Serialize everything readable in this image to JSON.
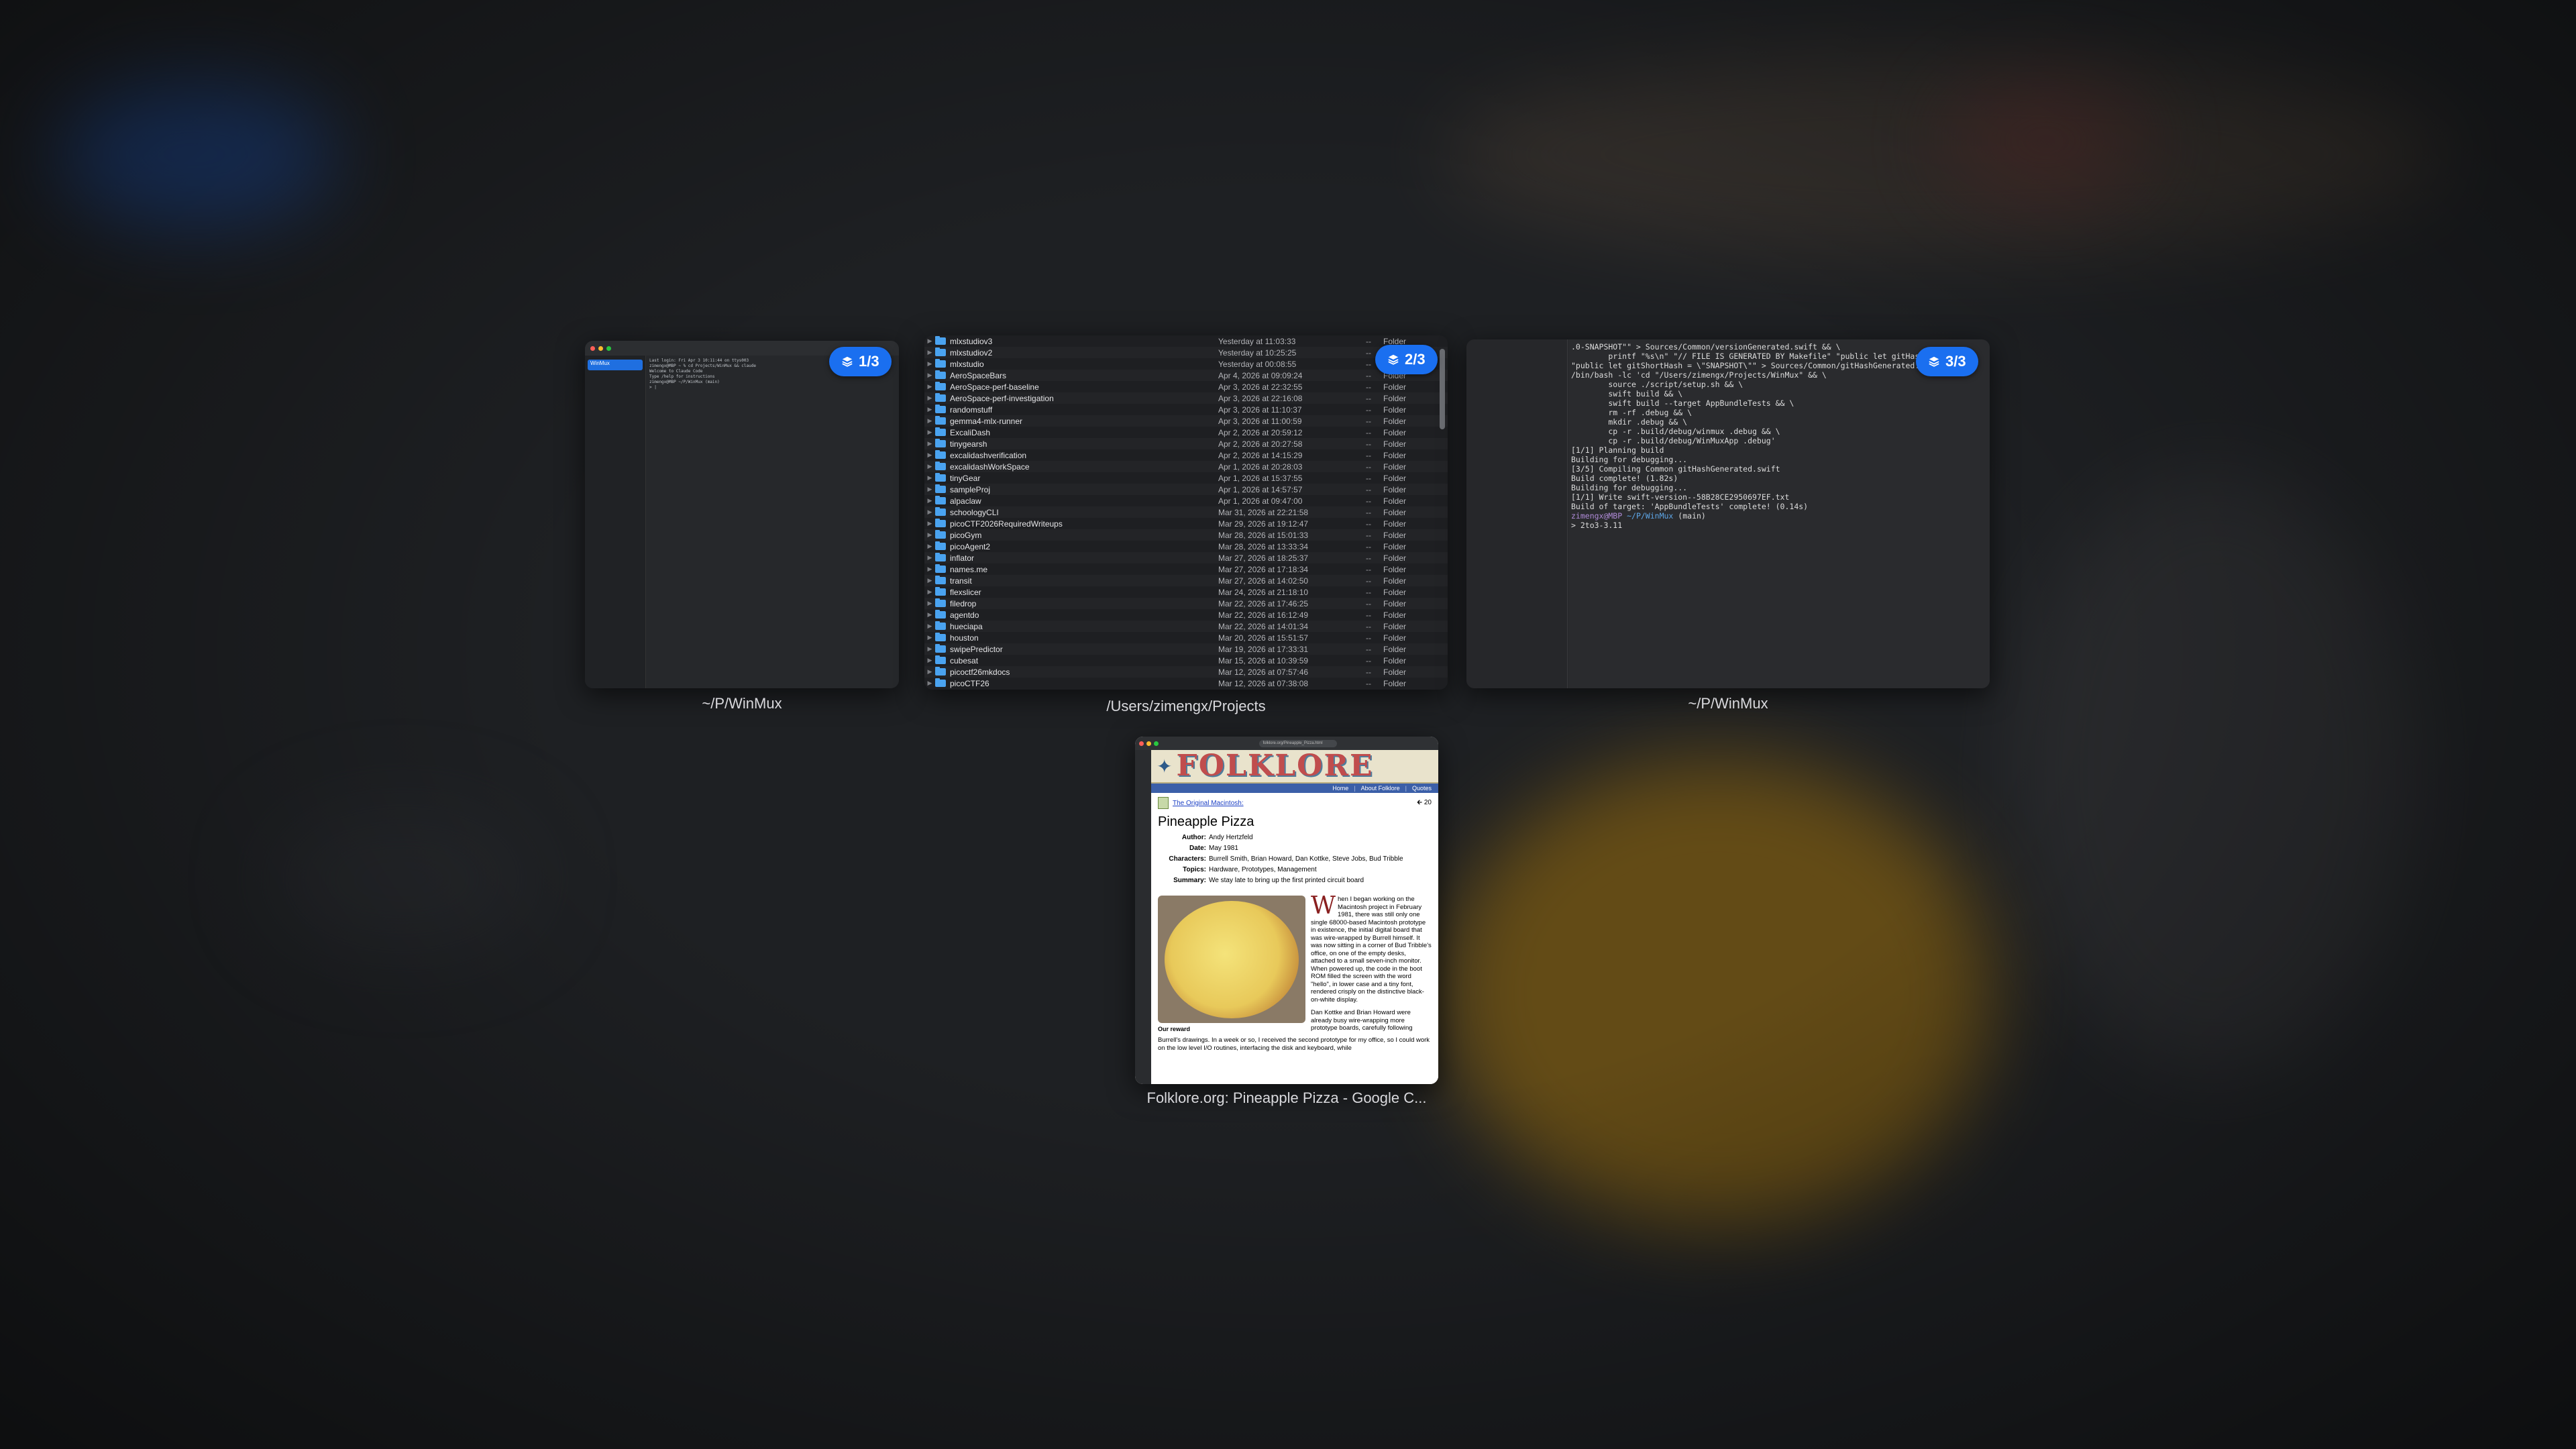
{
  "badge_windows": {
    "w1": "1/3",
    "w2": "2/3",
    "w3": "3/3"
  },
  "windows": [
    {
      "caption": "~/P/WinMux"
    },
    {
      "caption": "/Users/zimengx/Projects"
    },
    {
      "caption": "~/P/WinMux"
    },
    {
      "caption": "Folklore.org: Pineapple Pizza - Google C..."
    }
  ],
  "w1": {
    "sidebar_item": "WinMux",
    "lines": [
      "Last login: Fri Apr 3 10:11:44 on ttys003",
      "zimengx@MBP ~ % cd Projects/WinMux && claude",
      "Welcome to Claude Code",
      "Type /help for instructions",
      "zimengx@MBP ~/P/WinMux (main)",
      "> |"
    ]
  },
  "finder": {
    "rows": [
      {
        "name": "mlxstudiov3",
        "date": "Yesterday at 11:03:33",
        "size": "--",
        "kind": "Folder"
      },
      {
        "name": "mlxstudiov2",
        "date": "Yesterday at 10:25:25",
        "size": "--",
        "kind": "Folder"
      },
      {
        "name": "mlxstudio",
        "date": "Yesterday at 00:08:55",
        "size": "--",
        "kind": "Folder"
      },
      {
        "name": "AeroSpaceBars",
        "date": "Apr 4, 2026 at 09:09:24",
        "size": "--",
        "kind": "Folder"
      },
      {
        "name": "AeroSpace-perf-baseline",
        "date": "Apr 3, 2026 at 22:32:55",
        "size": "--",
        "kind": "Folder"
      },
      {
        "name": "AeroSpace-perf-investigation",
        "date": "Apr 3, 2026 at 22:16:08",
        "size": "--",
        "kind": "Folder"
      },
      {
        "name": "randomstuff",
        "date": "Apr 3, 2026 at 11:10:37",
        "size": "--",
        "kind": "Folder"
      },
      {
        "name": "gemma4-mlx-runner",
        "date": "Apr 3, 2026 at 11:00:59",
        "size": "--",
        "kind": "Folder"
      },
      {
        "name": "ExcaliDash",
        "date": "Apr 2, 2026 at 20:59:12",
        "size": "--",
        "kind": "Folder"
      },
      {
        "name": "tinygearsh",
        "date": "Apr 2, 2026 at 20:27:58",
        "size": "--",
        "kind": "Folder"
      },
      {
        "name": "excalidashverification",
        "date": "Apr 2, 2026 at 14:15:29",
        "size": "--",
        "kind": "Folder"
      },
      {
        "name": "excalidashWorkSpace",
        "date": "Apr 1, 2026 at 20:28:03",
        "size": "--",
        "kind": "Folder"
      },
      {
        "name": "tinyGear",
        "date": "Apr 1, 2026 at 15:37:55",
        "size": "--",
        "kind": "Folder"
      },
      {
        "name": "sampleProj",
        "date": "Apr 1, 2026 at 14:57:57",
        "size": "--",
        "kind": "Folder"
      },
      {
        "name": "alpaclaw",
        "date": "Apr 1, 2026 at 09:47:00",
        "size": "--",
        "kind": "Folder"
      },
      {
        "name": "schoologyCLI",
        "date": "Mar 31, 2026 at 22:21:58",
        "size": "--",
        "kind": "Folder"
      },
      {
        "name": "picoCTF2026RequiredWriteups",
        "date": "Mar 29, 2026 at 19:12:47",
        "size": "--",
        "kind": "Folder"
      },
      {
        "name": "picoGym",
        "date": "Mar 28, 2026 at 15:01:33",
        "size": "--",
        "kind": "Folder"
      },
      {
        "name": "picoAgent2",
        "date": "Mar 28, 2026 at 13:33:34",
        "size": "--",
        "kind": "Folder"
      },
      {
        "name": "inflator",
        "date": "Mar 27, 2026 at 18:25:37",
        "size": "--",
        "kind": "Folder"
      },
      {
        "name": "names.me",
        "date": "Mar 27, 2026 at 17:18:34",
        "size": "--",
        "kind": "Folder"
      },
      {
        "name": "transit",
        "date": "Mar 27, 2026 at 14:02:50",
        "size": "--",
        "kind": "Folder"
      },
      {
        "name": "flexslicer",
        "date": "Mar 24, 2026 at 21:18:10",
        "size": "--",
        "kind": "Folder"
      },
      {
        "name": "filedrop",
        "date": "Mar 22, 2026 at 17:46:25",
        "size": "--",
        "kind": "Folder"
      },
      {
        "name": "agentdo",
        "date": "Mar 22, 2026 at 16:12:49",
        "size": "--",
        "kind": "Folder"
      },
      {
        "name": "hueciapa",
        "date": "Mar 22, 2026 at 14:01:34",
        "size": "--",
        "kind": "Folder"
      },
      {
        "name": "houston",
        "date": "Mar 20, 2026 at 15:51:57",
        "size": "--",
        "kind": "Folder"
      },
      {
        "name": "swipePredictor",
        "date": "Mar 19, 2026 at 17:33:31",
        "size": "--",
        "kind": "Folder"
      },
      {
        "name": "cubesat",
        "date": "Mar 15, 2026 at 10:39:59",
        "size": "--",
        "kind": "Folder"
      },
      {
        "name": "picoctf26mkdocs",
        "date": "Mar 12, 2026 at 07:57:46",
        "size": "--",
        "kind": "Folder"
      },
      {
        "name": "picoCTF26",
        "date": "Mar 12, 2026 at 07:38:08",
        "size": "--",
        "kind": "Folder"
      }
    ]
  },
  "terminal": {
    "lines": [
      ".0-SNAPSHOT\"\" > Sources/Common/versionGenerated.swift && \\",
      "        printf \"%s\\n\" \"// FILE IS GENERATED BY Makefile\" \"public let gitHash",
      "\"public let gitShortHash = \\\"SNAPSHOT\\\"\" > Sources/Common/gitHashGenerated.sw",
      "/bin/bash -lc 'cd \"/Users/zimengx/Projects/WinMux\" && \\",
      "        source ./script/setup.sh && \\",
      "        swift build && \\",
      "        swift build --target AppBundleTests && \\",
      "        rm -rf .debug && \\",
      "        mkdir .debug && \\",
      "        cp -r .build/debug/winmux .debug && \\",
      "        cp -r .build/debug/WinMuxApp .debug'",
      "[1/1] Planning build",
      "Building for debugging...",
      "[3/5] Compiling Common gitHashGenerated.swift",
      "Build complete! (1.82s)",
      "Building for debugging...",
      "[1/1] Write swift-version--58B28CE2950697EF.txt",
      "Build of target: 'AppBundleTests' complete! (0.14s)"
    ],
    "prompt_user": "zimengx@MBP",
    "prompt_path": "~/P/WinMux",
    "prompt_branch": "(main)",
    "last_line": "> 2to3-3.11"
  },
  "browser": {
    "url": "folklore.org/Pineapple_Pizza.html",
    "logo": "FOLKLORE",
    "nav": [
      "Home",
      "About Folklore",
      "Quotes"
    ],
    "book_link": "The Original Macintosh:",
    "page_num": "20",
    "title": "Pineapple Pizza",
    "meta": [
      {
        "k": "Author:",
        "v": "Andy Hertzfeld"
      },
      {
        "k": "Date:",
        "v": "May 1981"
      },
      {
        "k": "Characters:",
        "v": "Burrell Smith, Brian Howard, Dan Kottke, Steve Jobs, Bud Tribble"
      },
      {
        "k": "Topics:",
        "v": "Hardware, Prototypes, Management"
      },
      {
        "k": "Summary:",
        "v": "We stay late to bring up the first printed circuit board"
      }
    ],
    "photo_caption": "Our reward",
    "dropcap": "W",
    "para1": "hen I began working on the Macintosh project in February 1981, there was still only one single 68000-based Macintosh prototype in existence, the initial digital board that was wire-wrapped by Burrell himself. It was now sitting in a corner of Bud Tribble's office, on one of the empty desks, attached to a small seven-inch monitor. When powered up, the code in the boot ROM filled the screen with the word \"hello\", in lower case and a tiny font, rendered crisply on the distinctive black-on-white display.",
    "para2": "Dan Kottke and Brian Howard were already busy wire-wrapping more prototype boards, carefully following",
    "bottom": "Burrell's drawings. In a week or so, I received the second prototype for my office, so I could work on the low level I/O routines, interfacing the disk and keyboard, while"
  }
}
